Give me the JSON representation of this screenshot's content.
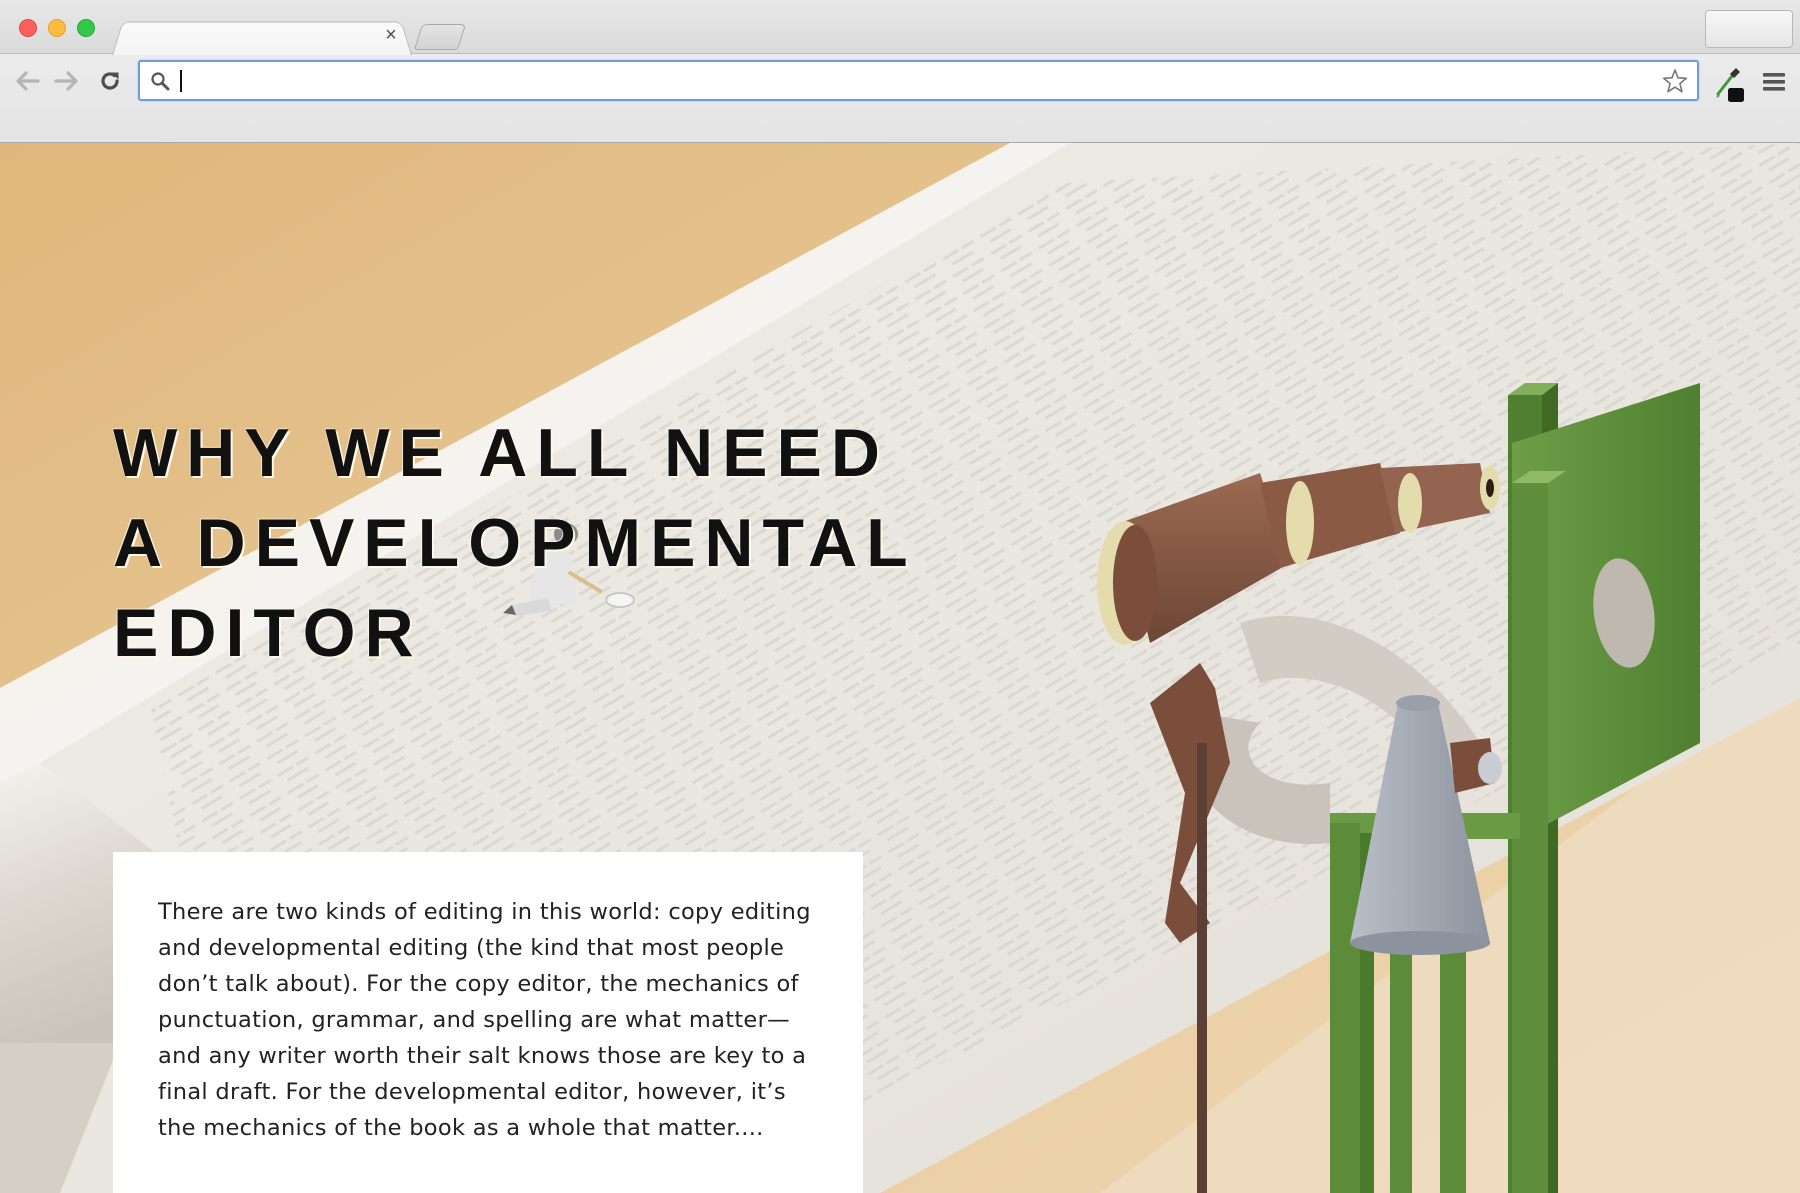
{
  "browser": {
    "tab": {
      "title": "",
      "close_glyph": "×"
    },
    "toolbar": {
      "back_icon": "back-arrow-icon",
      "forward_icon": "forward-arrow-icon",
      "reload_icon": "reload-icon",
      "address_value": "",
      "address_placeholder": "",
      "bookmark_icon": "star-icon",
      "extension_icon": "eyedropper-icon",
      "menu_icon": "hamburger-menu-icon"
    },
    "window_controls": [
      "close",
      "minimize",
      "maximize"
    ]
  },
  "hero": {
    "headline_lines": [
      "WHY WE ALL NEED",
      "A DEVELOPMENTAL",
      "EDITOR"
    ],
    "intro": "There are two kinds of editing in this world: copy editing and developmental editing (the kind that most people don’t talk about). For the copy editor, the mechanics of punctuation, grammar, and spelling are what matter—and any writer worth their salt knows those are key to a final draft. For the developmental editor, however, it’s the mechanics of the book as a whole that matter....",
    "illustration": "isometric-telescope-on-green-stand-over-paper-scroll"
  },
  "colors": {
    "background_tan": "#e6c79a",
    "paper": "#eeeae4",
    "stand_green": "#5c8c3a",
    "telescope_brown": "#8a5a45",
    "address_focus_blue": "#6e9fdc",
    "traffic_close": "#fc605b",
    "traffic_minimize": "#fdbc40",
    "traffic_maximize": "#34c84a"
  }
}
